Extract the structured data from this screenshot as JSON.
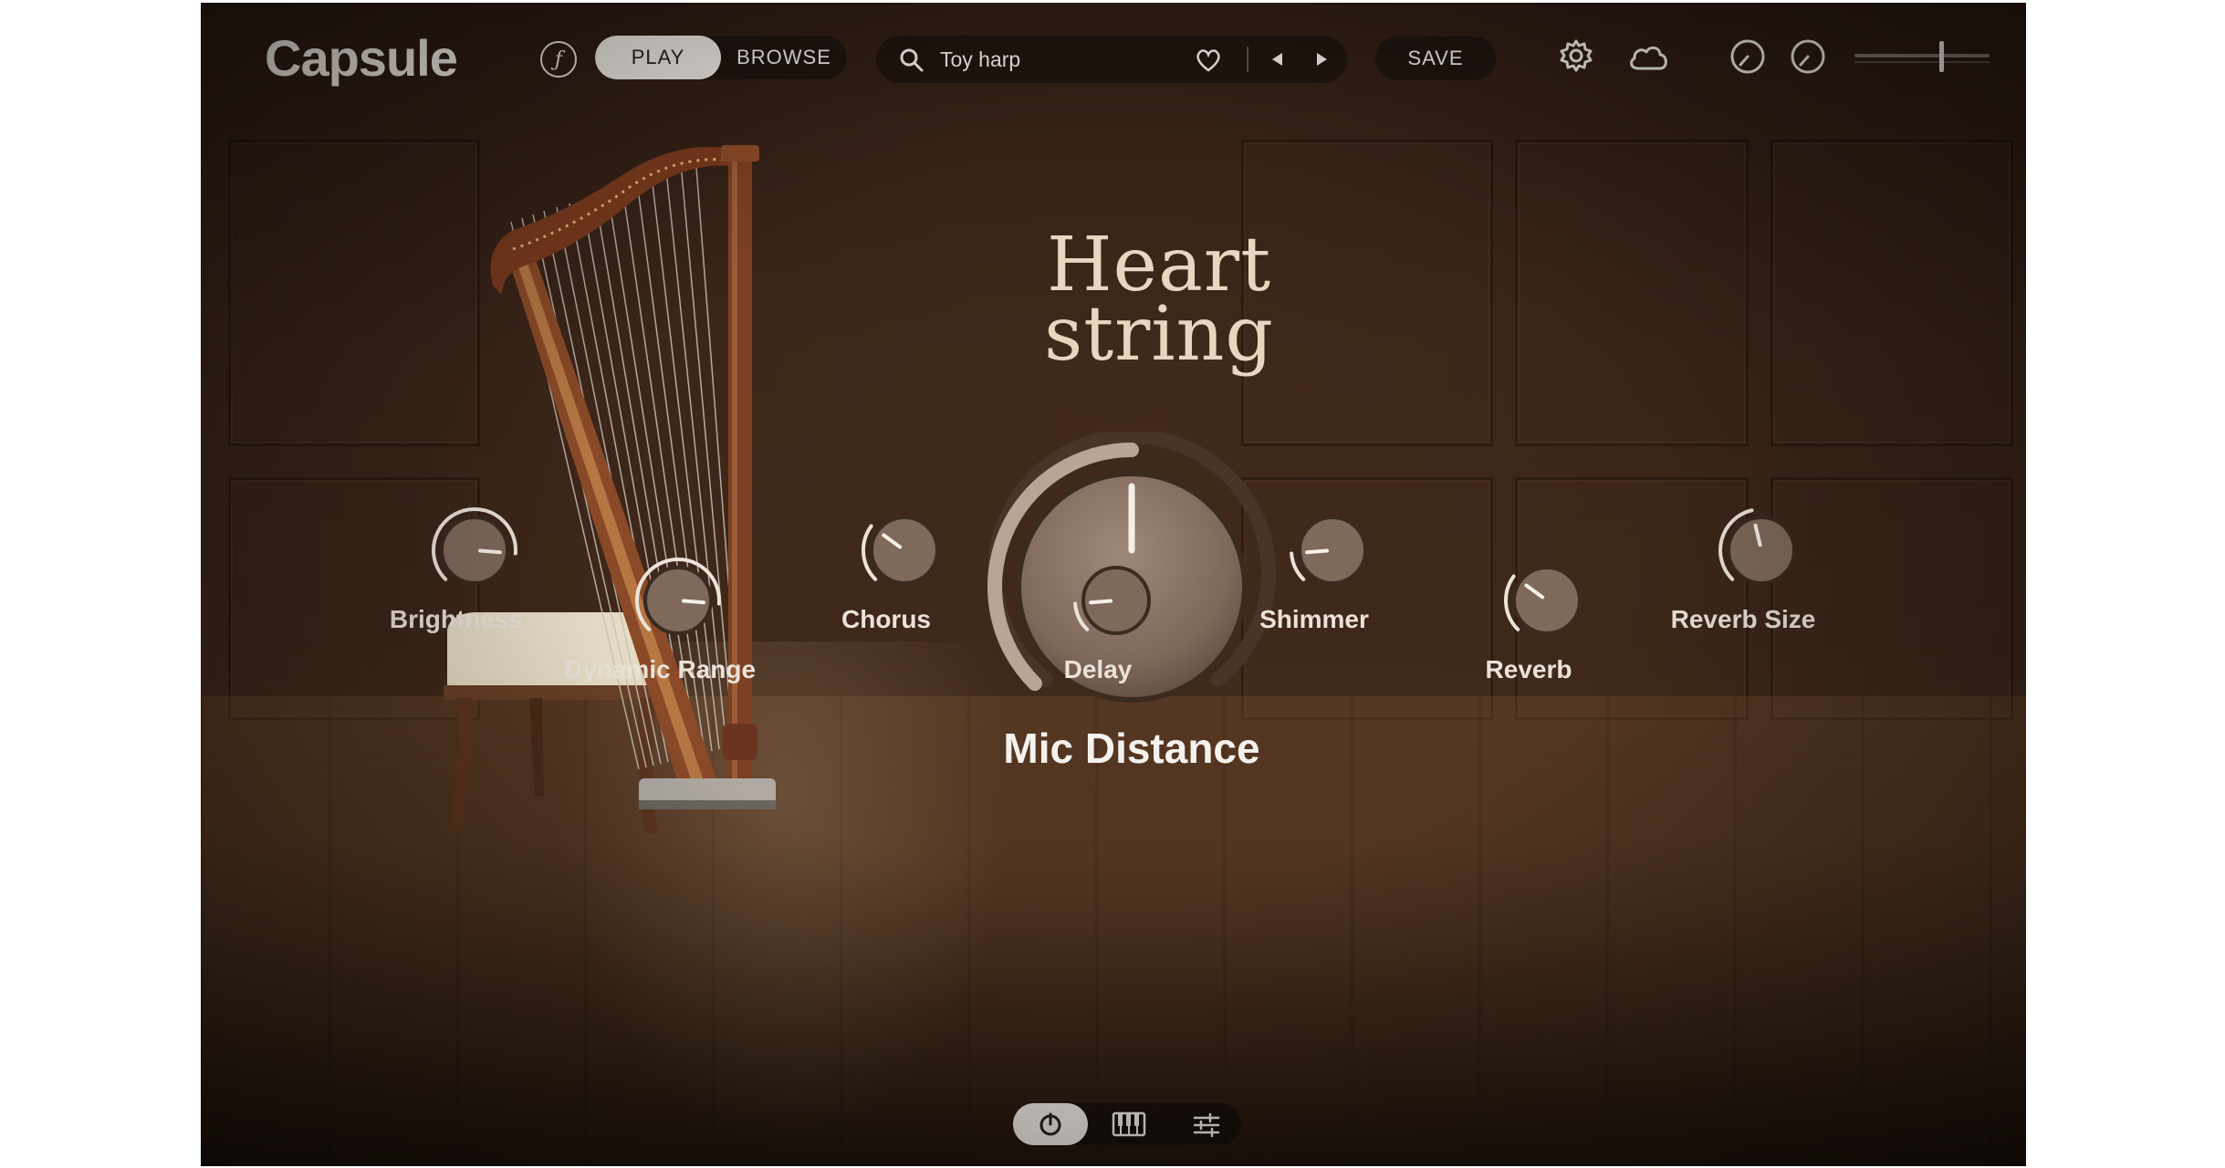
{
  "app": {
    "logo": "Capsule"
  },
  "topbar": {
    "mode_tabs": [
      {
        "label": "PLAY",
        "active": true
      },
      {
        "label": "BROWSE",
        "active": false
      }
    ],
    "search": {
      "value": "Toy harp"
    },
    "save_label": "SAVE",
    "volume": 0.64
  },
  "instrument": {
    "title_line1": "Heart",
    "title_line2": "string"
  },
  "main_control": {
    "label": "Mic Distance",
    "value": 0.5
  },
  "knobs": [
    {
      "label": "Brightness",
      "value": 0.85
    },
    {
      "label": "Dynamic Range",
      "value": 0.85
    },
    {
      "label": "Chorus",
      "value": 0.3
    },
    {
      "label": "Delay",
      "value": 0.15
    },
    {
      "label": "Shimmer",
      "value": 0.15
    },
    {
      "label": "Reverb",
      "value": 0.3
    },
    {
      "label": "Reverb Size",
      "value": 0.45
    }
  ],
  "bottom_tabs": [
    {
      "icon": "power-icon",
      "active": true
    },
    {
      "icon": "piano-keys-icon",
      "active": false
    },
    {
      "icon": "sliders-icon",
      "active": false
    }
  ],
  "colors": {
    "accent": "#e9d6c0",
    "knob": "#8a7466",
    "text": "#f5f1ec"
  }
}
